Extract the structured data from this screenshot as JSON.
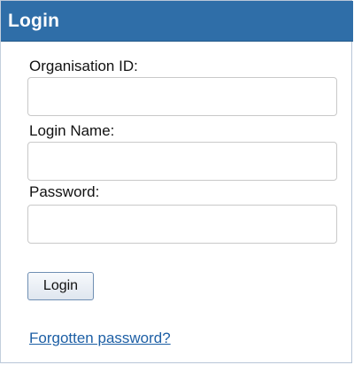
{
  "panel": {
    "title": "Login"
  },
  "form": {
    "organisation_id": {
      "label": "Organisation ID:",
      "value": "",
      "placeholder": ""
    },
    "login_name": {
      "label": "Login Name:",
      "value": "",
      "placeholder": ""
    },
    "password": {
      "label": "Password:",
      "value": "",
      "placeholder": ""
    },
    "submit_label": "Login",
    "forgot_password_label": "Forgotten password?"
  },
  "colors": {
    "header_background": "#2f6ea8",
    "link": "#1d5fa5"
  }
}
